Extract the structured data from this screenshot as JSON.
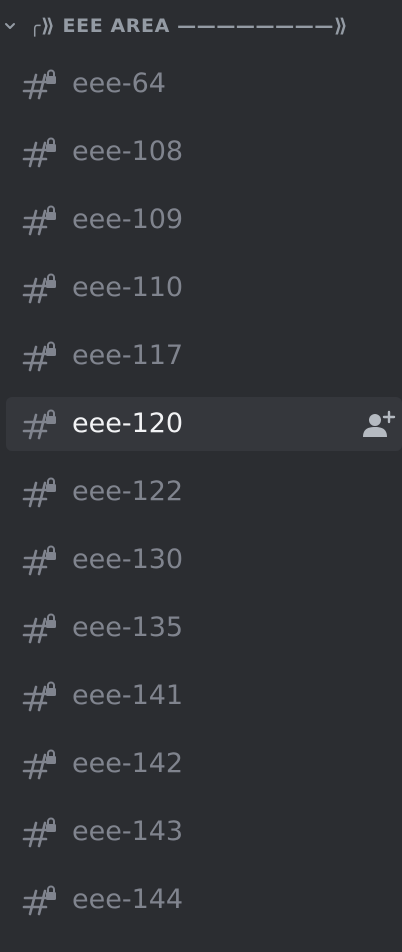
{
  "category": {
    "name": "╭⟫ EEE AREA ————————⟫"
  },
  "channels": [
    {
      "name": "eee-64"
    },
    {
      "name": "eee-108"
    },
    {
      "name": "eee-109"
    },
    {
      "name": "eee-110"
    },
    {
      "name": "eee-117"
    },
    {
      "name": "eee-120",
      "selected": true
    },
    {
      "name": "eee-122"
    },
    {
      "name": "eee-130"
    },
    {
      "name": "eee-135"
    },
    {
      "name": "eee-141"
    },
    {
      "name": "eee-142"
    },
    {
      "name": "eee-143"
    },
    {
      "name": "eee-144"
    }
  ],
  "icons": {
    "channel": "locked-text-channel-icon",
    "invite": "create-invite-icon",
    "collapse": "chevron-down-icon"
  },
  "colors": {
    "background": "#2b2d31",
    "selected_background": "#35373c",
    "text_muted": "#80848e",
    "text_selected": "#f2f3f5",
    "category_text": "#949ba4"
  }
}
